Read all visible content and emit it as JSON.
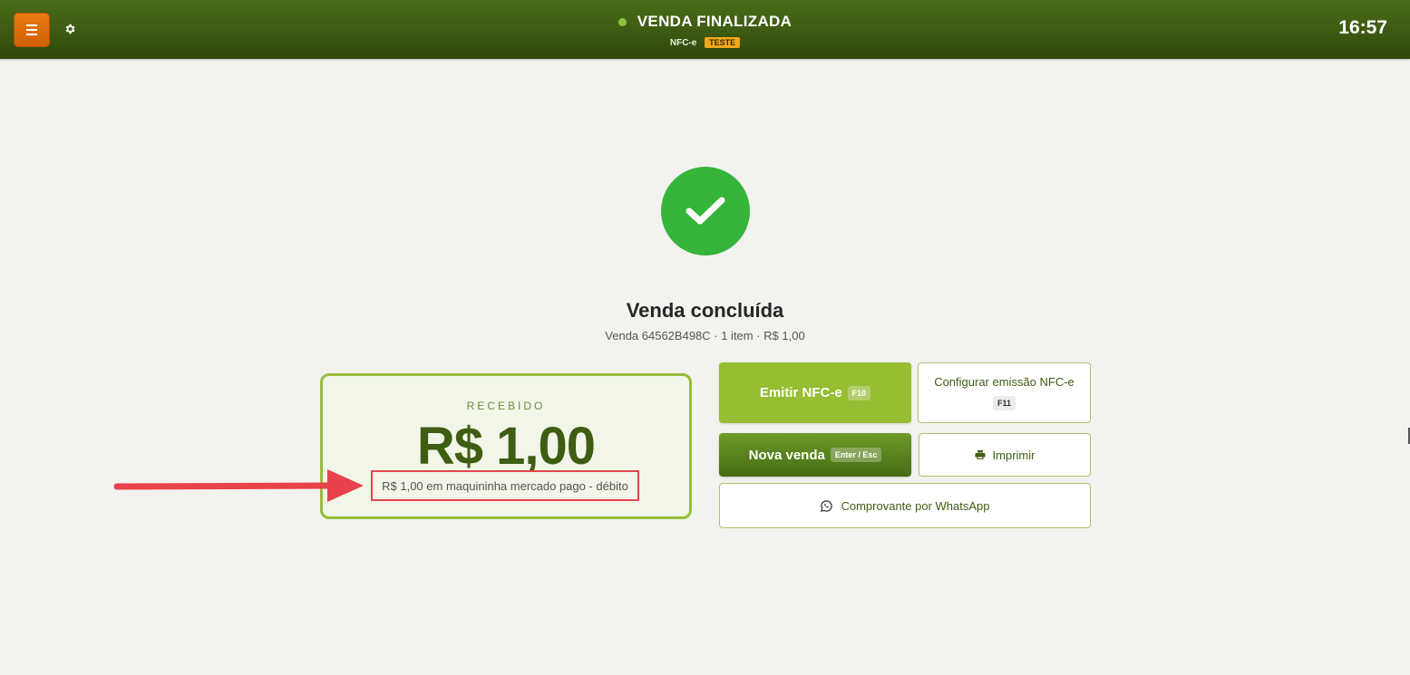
{
  "header": {
    "status_title": "VENDA FINALIZADA",
    "doc_type": "NFC-e",
    "env_badge": "TESTE",
    "clock": "16:57",
    "colors": {
      "bar": "#3d5a12",
      "menu_button": "#e06f0c",
      "status_dot": "#8cc63f",
      "badge": "#f0a81c"
    }
  },
  "icons": {
    "menu": "hamburger-icon",
    "settings": "gear-icon",
    "success": "checkmark-icon",
    "print": "printer-icon",
    "whatsapp": "whatsapp-icon"
  },
  "sale": {
    "heading": "Venda concluída",
    "summary": "Venda 64562B498C · 1 item · R$ 1,00"
  },
  "received": {
    "label": "RECEBIDO",
    "amount": "R$ 1,00",
    "detail": "R$ 1,00 em maquininha mercado pago - débito"
  },
  "actions": {
    "emitir": {
      "label": "Emitir NFC-e",
      "shortcut": "F10"
    },
    "configurar": {
      "label": "Configurar emissão NFC-e",
      "shortcut": "F11"
    },
    "nova_venda": {
      "label": "Nova venda",
      "shortcut": "Enter / Esc"
    },
    "imprimir": {
      "label": "Imprimir"
    },
    "whatsapp": {
      "label": "Comprovante por WhatsApp"
    }
  }
}
